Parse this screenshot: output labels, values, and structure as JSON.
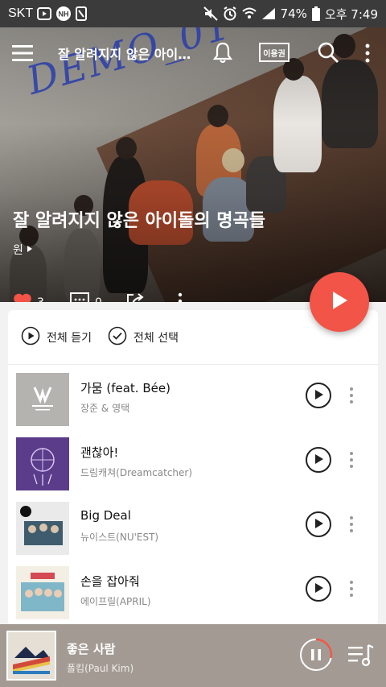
{
  "status_bar": {
    "carrier": "SKT",
    "battery": "74%",
    "time": "오후 7:49"
  },
  "header": {
    "title": "잘 알려지지 않은 아이…",
    "pass_label": "이용권",
    "watermark": "DEMO_01"
  },
  "playlist": {
    "title": "잘 알려지지 않은 아이돌의 명곡들",
    "author": "원",
    "likes": "3",
    "comments": "0"
  },
  "actions": {
    "play_all": "전체 듣기",
    "select_all": "전체 선택"
  },
  "tracks": [
    {
      "title": "가뭄 (feat. Bée)",
      "artist": "장준 & 영택"
    },
    {
      "title": "괜찮아!",
      "artist": "드림캐쳐(Dreamcatcher)"
    },
    {
      "title": "Big Deal",
      "artist": "뉴이스트(NU'EST)"
    },
    {
      "title": "손을 잡아줘",
      "artist": "에이프릴(APRIL)"
    }
  ],
  "now_playing": {
    "title": "좋은 사람",
    "artist": "폴킴(Paul Kim)"
  },
  "colors": {
    "accent": "#f25447",
    "mini_player_bg": "#a39b93",
    "status_bar_bg": "#3b3b3b"
  },
  "icons": [
    "menu-icon",
    "bell-icon",
    "search-icon",
    "more-vertical-icon",
    "heart-icon",
    "comment-icon",
    "share-icon",
    "play-icon",
    "check-circle-icon",
    "pause-icon",
    "playlist-icon"
  ]
}
